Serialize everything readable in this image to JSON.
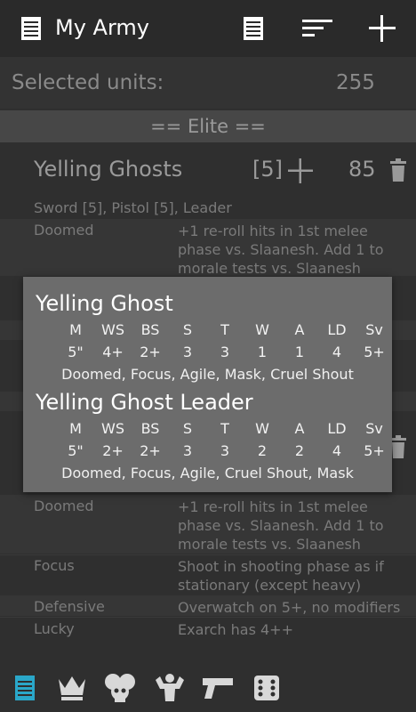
{
  "app": {
    "title": "My Army",
    "toolbar_icons": [
      "list-icon",
      "sort-icon",
      "add-icon"
    ]
  },
  "selected_units": {
    "label": "Selected units:",
    "value": "255"
  },
  "section_header": "== Elite ==",
  "unit": {
    "name": "Yelling Ghosts",
    "count": "[5]",
    "points": "85",
    "wargear": "Sword [5], Pistol [5], Leader",
    "rules": [
      {
        "name": "Doomed",
        "text": "+1 re-roll hits in 1st melee phase vs. Slaanesh. Add 1 to morale tests vs. Slaanesh"
      }
    ]
  },
  "lower_rules": [
    {
      "name": "Doomed",
      "text": "+1 re-roll hits in 1st melee phase vs. Slaanesh. Add 1 to morale tests vs. Slaanesh"
    },
    {
      "name": "Focus",
      "text": "Shoot in shooting phase as if stationary (except heavy)"
    },
    {
      "name": "Defensive",
      "text": "Overwatch on 5+, no modifiers"
    },
    {
      "name": "Lucky",
      "text": "Exarch has 4++"
    }
  ],
  "stat_headers": [
    "M",
    "WS",
    "BS",
    "S",
    "T",
    "W",
    "A",
    "LD",
    "Sv"
  ],
  "profiles": [
    {
      "name": "Yelling Ghost",
      "stats": [
        "5\"",
        "4+",
        "2+",
        "3",
        "3",
        "1",
        "1",
        "4",
        "5+"
      ],
      "abilities": "Doomed, Focus, Agile, Mask, Cruel Shout"
    },
    {
      "name": "Yelling Ghost Leader",
      "stats": [
        "5\"",
        "2+",
        "2+",
        "3",
        "3",
        "2",
        "2",
        "4",
        "5+"
      ],
      "abilities": "Doomed, Focus, Agile, Cruel Shout, Mask"
    }
  ],
  "bottom_nav": [
    "list-icon",
    "crown-icon",
    "skulls-icon",
    "strength-icon",
    "pistol-icon",
    "dice-icon"
  ],
  "colors": {
    "active_tab": "#2aa7c9",
    "card_bg": "#6c6c6c",
    "background": "#2f2f2f"
  }
}
